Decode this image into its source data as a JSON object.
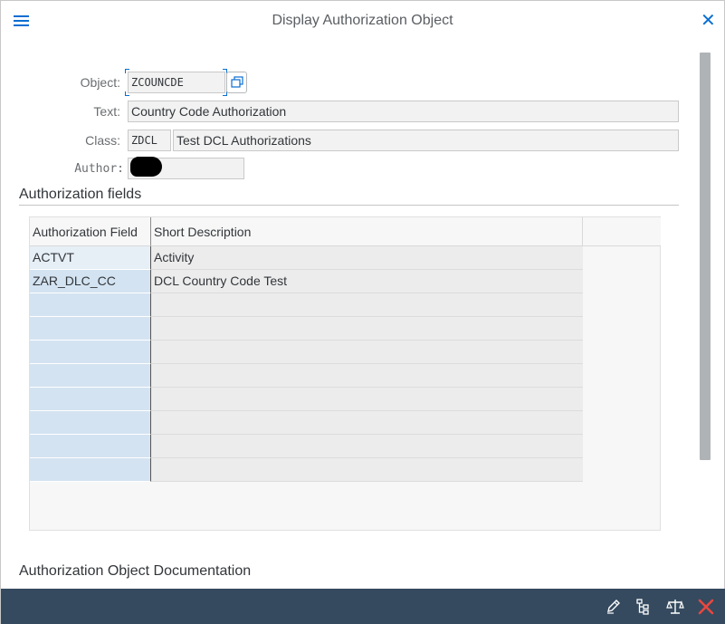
{
  "dialog": {
    "title": "Display Authorization Object"
  },
  "form": {
    "object_label": "Object:",
    "object_value": "ZCOUNCDE",
    "text_label": "Text:",
    "text_value": "Country Code Authorization",
    "class_label": "Class:",
    "class_code": "ZDCL",
    "class_desc": "Test DCL Authorizations",
    "author_label": "Author:"
  },
  "fields_section": {
    "title": "Authorization fields",
    "columns": [
      "Authorization Field",
      "Short Description"
    ],
    "rows": [
      {
        "field": "ACTVT",
        "description": "Activity"
      },
      {
        "field": "ZAR_DLC_CC",
        "description": "DCL Country Code Test"
      }
    ]
  },
  "documentation_section": {
    "title": "Authorization Object Documentation"
  },
  "footer": {
    "icons": [
      "edit-icon",
      "where-used-icon",
      "compare-icon",
      "cancel-icon"
    ]
  },
  "colors": {
    "accent": "#0a6ed1",
    "footer_bg": "#354a5f",
    "cancel_red": "#e9473f"
  }
}
